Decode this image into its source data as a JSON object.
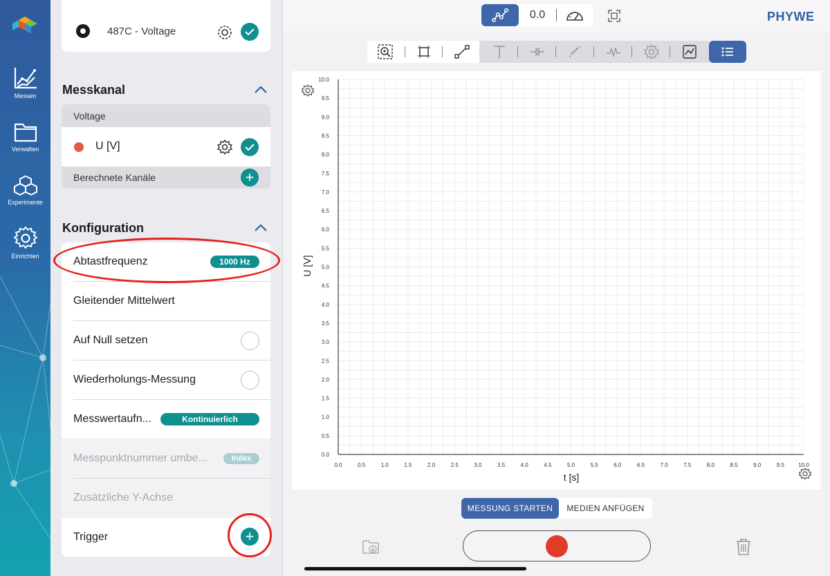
{
  "rail": {
    "items": [
      {
        "label": "Messen",
        "icon": "chart-line-icon"
      },
      {
        "label": "Verwalten",
        "icon": "folder-icon"
      },
      {
        "label": "Experimente",
        "icon": "cubes-icon"
      },
      {
        "label": "Einrichten",
        "icon": "gear-icon"
      }
    ]
  },
  "panel": {
    "sensor": {
      "label": "487C - Voltage"
    },
    "messkanal": {
      "title": "Messkanal",
      "group_label": "Voltage",
      "channel_label": "U [V]",
      "channel_color": "#e05a46",
      "computed_label": "Berechnete Kanäle"
    },
    "konfiguration": {
      "title": "Konfiguration",
      "rows": [
        {
          "label": "Abtastfrequenz",
          "value": "1000 Hz"
        },
        {
          "label": "Gleitender Mittelwert"
        },
        {
          "label": "Auf Null setzen"
        },
        {
          "label": "Wiederholungs-Messung"
        },
        {
          "label": "Messwertaufn...",
          "value": "Kontinuierlich"
        },
        {
          "label": "Messpunktnummer umbe...",
          "value": "Index"
        },
        {
          "label": "Zusätzliche Y-Achse"
        },
        {
          "label": "Trigger"
        }
      ]
    }
  },
  "header": {
    "live_value": "0.0",
    "brand": "PHYWE"
  },
  "chart_data": {
    "type": "line",
    "x": [],
    "series": [
      {
        "values": []
      }
    ],
    "xlabel": "t [s]",
    "ylabel": "U [V]",
    "xlim": [
      0,
      10
    ],
    "ylim": [
      0,
      10
    ],
    "grid": true,
    "x_ticks": [
      "0.0",
      "0.5",
      "1.0",
      "1.5",
      "2.0",
      "2.5",
      "3.0",
      "3.5",
      "4.0",
      "4.5",
      "5.0",
      "5.5",
      "6.0",
      "6.5",
      "7.0",
      "7.5",
      "8.0",
      "8.5",
      "9.0",
      "9.5",
      "10.0"
    ],
    "y_ticks": [
      "0.0",
      "0.5",
      "1.0",
      "1.5",
      "2.0",
      "2.5",
      "3.0",
      "3.5",
      "4.0",
      "4.5",
      "5.0",
      "5.5",
      "6.0",
      "6.5",
      "7.0",
      "7.5",
      "8.0",
      "8.5",
      "9.0",
      "9.5",
      "10.0"
    ]
  },
  "bottom": {
    "start_label": "MESSUNG STARTEN",
    "media_label": "MEDIEN ANFÜGEN"
  },
  "colors": {
    "accent_blue": "#3f66a8",
    "teal": "#0f8f8f",
    "record_red": "#e23b2a",
    "annotation_red": "#e5201d"
  }
}
